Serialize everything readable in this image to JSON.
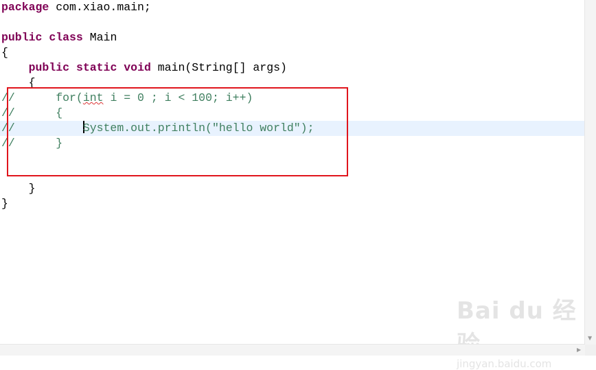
{
  "editor": {
    "lines": [
      {
        "kw": "package",
        "rest": " com.xiao.main;"
      },
      {
        "kw": "public",
        "kw2": "class",
        "rest": " Main"
      },
      {
        "text": "{"
      },
      {
        "indent": "    ",
        "kw": "public",
        "kw2": "static",
        "kw3": "void",
        "rest": " main(String[] args)"
      },
      {
        "text": "    {"
      },
      {
        "comment": "//      ",
        "pre": "for(",
        "sq": "int",
        "post": " i = 0 ; i < 100; i++)"
      },
      {
        "comment": "//      {"
      },
      {
        "comment": "//          ",
        "code": "System.out.println(\"hello world\");"
      },
      {
        "comment": "//      }"
      },
      {
        "text": "    }"
      },
      {
        "text": "}"
      }
    ]
  },
  "watermark": {
    "brand": "Bai du 经验",
    "url": "jingyan.baidu.com"
  },
  "colors": {
    "keyword": "#7f0055",
    "comment": "#3f7f5f",
    "highlight": "#e8f2fe",
    "annotation_box": "#e0141c"
  }
}
